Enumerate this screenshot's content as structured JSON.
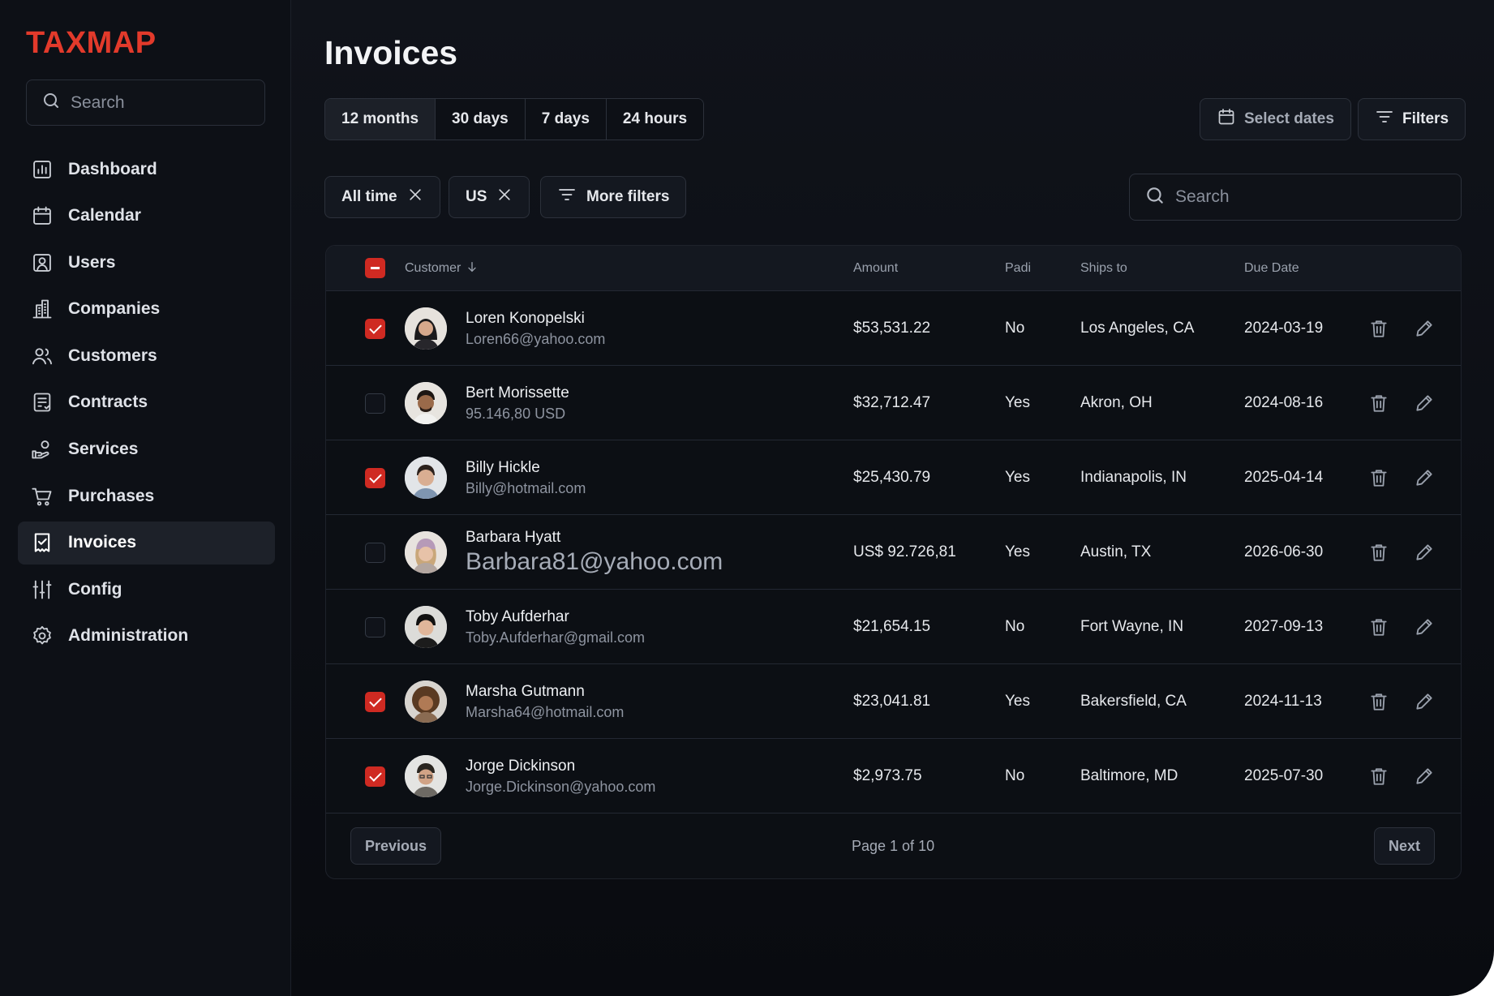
{
  "brand": {
    "logo": "TAXMAP",
    "accent": "#e23a2b"
  },
  "sidebar": {
    "search_placeholder": "Search",
    "items": [
      {
        "label": "Dashboard",
        "icon": "chart-icon",
        "active": false
      },
      {
        "label": "Calendar",
        "icon": "calendar-icon",
        "active": false
      },
      {
        "label": "Users",
        "icon": "user-icon",
        "active": false
      },
      {
        "label": "Companies",
        "icon": "building-icon",
        "active": false
      },
      {
        "label": "Customers",
        "icon": "users-icon",
        "active": false
      },
      {
        "label": "Contracts",
        "icon": "document-icon",
        "active": false
      },
      {
        "label": "Services",
        "icon": "hand-icon",
        "active": false
      },
      {
        "label": "Purchases",
        "icon": "cart-icon",
        "active": false
      },
      {
        "label": "Invoices",
        "icon": "invoice-icon",
        "active": true
      },
      {
        "label": "Config",
        "icon": "sliders-icon",
        "active": false
      },
      {
        "label": "Administration",
        "icon": "gear-icon",
        "active": false
      }
    ]
  },
  "main": {
    "title": "Invoices",
    "ranges": [
      "12 months",
      "30 days",
      "7 days",
      "24 hours"
    ],
    "active_range": "12 months",
    "select_dates_label": "Select dates",
    "filters_label": "Filters",
    "chips": [
      "All time",
      "US"
    ],
    "more_filters_label": "More filters",
    "search_placeholder": "Search"
  },
  "table": {
    "columns": {
      "customer": "Customer",
      "amount": "Amount",
      "paid": "Padi",
      "ships_to": "Ships to",
      "due_date": "Due Date"
    },
    "rows": [
      {
        "checked": true,
        "name": "Loren Konopelski",
        "sub": "Loren66@yahoo.com",
        "amount": "$53,531.22",
        "paid": "No",
        "ships_to": "Los Angeles, CA",
        "due": "2024-03-19"
      },
      {
        "checked": false,
        "name": "Bert Morissette",
        "sub": "95.146,80 USD",
        "amount": "$32,712.47",
        "paid": "Yes",
        "ships_to": "Akron, OH",
        "due": "2024-08-16"
      },
      {
        "checked": true,
        "name": "Billy Hickle",
        "sub": "Billy@hotmail.com",
        "amount": "$25,430.79",
        "paid": "Yes",
        "ships_to": "Indianapolis, IN",
        "due": "2025-04-14"
      },
      {
        "checked": false,
        "name": "Barbara Hyatt",
        "sub": "Barbara81@yahoo.com",
        "amount": "US$ 92.726,81",
        "paid": "Yes",
        "ships_to": "Austin, TX",
        "due": "2026-06-30"
      },
      {
        "checked": false,
        "name": "Toby Aufderhar",
        "sub": "Toby.Aufderhar@gmail.com",
        "amount": "$21,654.15",
        "paid": "No",
        "ships_to": "Fort Wayne, IN",
        "due": "2027-09-13"
      },
      {
        "checked": true,
        "name": "Marsha Gutmann",
        "sub": "Marsha64@hotmail.com",
        "amount": "$23,041.81",
        "paid": "Yes",
        "ships_to": "Bakersfield, CA",
        "due": "2024-11-13"
      },
      {
        "checked": true,
        "name": "Jorge Dickinson",
        "sub": "Jorge.Dickinson@yahoo.com",
        "amount": "$2,973.75",
        "paid": "No",
        "ships_to": "Baltimore, MD",
        "due": "2025-07-30"
      }
    ]
  },
  "pagination": {
    "previous": "Previous",
    "info": "Page 1 of 10",
    "next": "Next"
  }
}
